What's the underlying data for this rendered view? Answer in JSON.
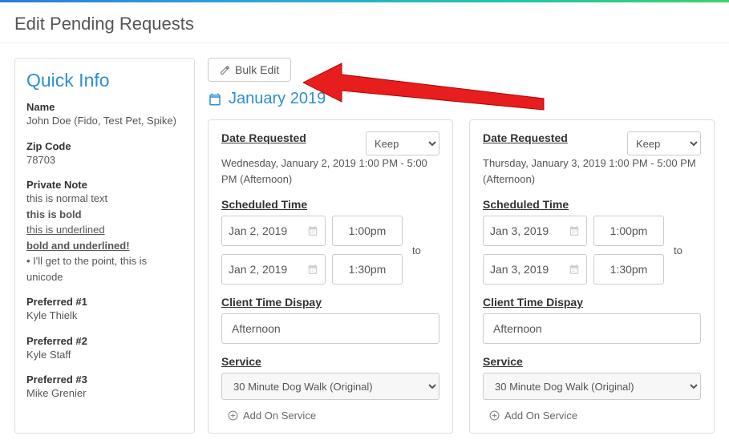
{
  "page": {
    "title": "Edit Pending Requests"
  },
  "sidebar": {
    "heading": "Quick Info",
    "name_label": "Name",
    "name_value": "John Doe (Fido, Test Pet, Spike)",
    "zip_label": "Zip Code",
    "zip_value": "78703",
    "note_label": "Private Note",
    "note_line1": "this is normal text",
    "note_line2": "this is bold",
    "note_line3": "this is underlined",
    "note_line4": "bold and underlined!",
    "note_line5": "• I'll get to the point, this is unicode",
    "pref1_label": "Preferred #1",
    "pref1_value": "Kyle Thielk",
    "pref2_label": "Preferred #2",
    "pref2_value": "Kyle Staff",
    "pref3_label": "Preferred #3",
    "pref3_value": "Mike Grenier"
  },
  "main": {
    "bulk_edit": "Bulk Edit",
    "month": "January 2019",
    "to_label": "to",
    "addon_label": "Add On Service",
    "labels": {
      "date_requested": "Date Requested",
      "scheduled_time": "Scheduled Time",
      "client_display": "Client Time Dispay",
      "service": "Service"
    }
  },
  "cards": [
    {
      "keep": "Keep",
      "date_text": "Wednesday, January 2, 2019 1:00 PM - 5:00 PM (Afternoon)",
      "start_date": "Jan 2, 2019",
      "start_time": "1:00pm",
      "end_date": "Jan 2, 2019",
      "end_time": "1:30pm",
      "client_display": "Afternoon",
      "service": "30 Minute Dog Walk (Original)"
    },
    {
      "keep": "Keep",
      "date_text": "Thursday, January 3, 2019 1:00 PM - 5:00 PM (Afternoon)",
      "start_date": "Jan 3, 2019",
      "start_time": "1:00pm",
      "end_date": "Jan 3, 2019",
      "end_time": "1:30pm",
      "client_display": "Afternoon",
      "service": "30 Minute Dog Walk (Original)"
    }
  ]
}
